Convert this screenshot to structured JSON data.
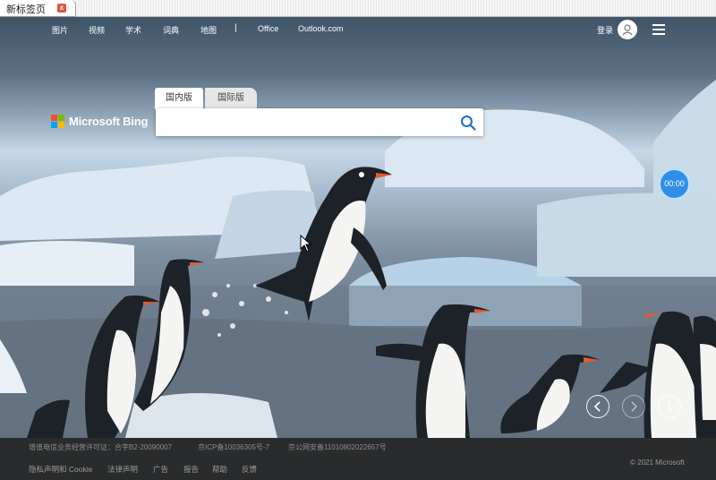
{
  "browser": {
    "tab_title": "新标签页",
    "tab_close": "x"
  },
  "nav": {
    "items": [
      "图片",
      "视频",
      "学术",
      "词典",
      "地图"
    ],
    "separator": "|",
    "links": [
      "Office",
      "Outlook.com"
    ],
    "login": "登录"
  },
  "logo": {
    "text": "Microsoft Bing"
  },
  "search": {
    "tab_domestic": "国内版",
    "tab_international": "国际版",
    "placeholder": ""
  },
  "timer": {
    "value": "00:00"
  },
  "footer": {
    "license_lines": [
      "增值电信业务经营许可证：合字B2-20090007",
      "京ICP备10036305号-7",
      "京公网安备11010802022657号"
    ],
    "links": [
      "隐私声明和 Cookie",
      "法律声明",
      "广告",
      "报告",
      "帮助",
      "反馈"
    ],
    "copyright": "© 2021 Microsoft"
  },
  "colors": {
    "timer_blue": "#2f8fe8",
    "footer_bg": "#2a2b2c",
    "bing_logo": [
      "#f25022",
      "#7fba00",
      "#00a4ef",
      "#ffb900"
    ]
  }
}
